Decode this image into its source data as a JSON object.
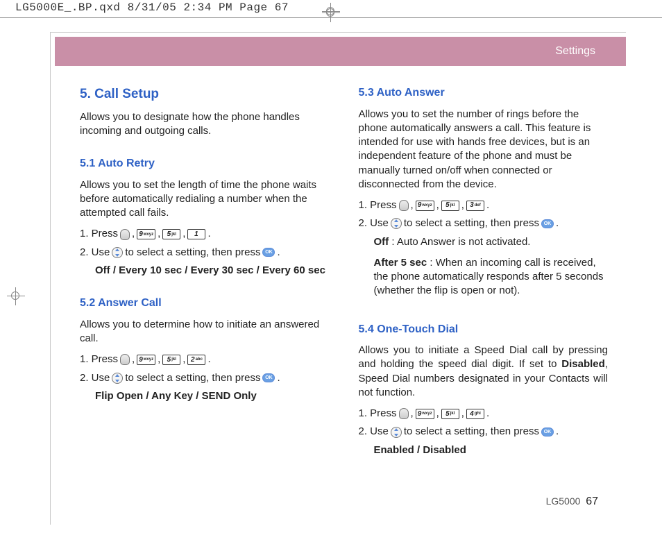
{
  "crop_header": "LG5000E_.BP.qxd  8/31/05  2:34 PM  Page 67",
  "banner_title": "Settings",
  "footer_model": "LG5000",
  "footer_page": "67",
  "keys": {
    "k9": {
      "num": "9",
      "lbl": "wxyz"
    },
    "k5": {
      "num": "5",
      "lbl": "jkl"
    },
    "k1": {
      "num": "1",
      "lbl": ""
    },
    "k2": {
      "num": "2",
      "lbl": "abc"
    },
    "k3": {
      "num": "3",
      "lbl": "def"
    },
    "k4": {
      "num": "4",
      "lbl": "ghi"
    },
    "ok": "OK"
  },
  "left": {
    "h2": "5. Call Setup",
    "intro": "Allows you to designate how the phone handles incoming and outgoing calls.",
    "s1": {
      "title": "5.1 Auto Retry",
      "desc": "Allows you to set the length of time the phone waits before automatically redialing a number when the attempted call fails.",
      "step1_a": "1. Press",
      "step2_a": "2. Use",
      "step2_b": "to select a setting, then press",
      "opts": "Off / Every 10 sec / Every 30 sec / Every 60 sec"
    },
    "s2": {
      "title": "5.2 Answer Call",
      "desc": "Allows you to determine how to initiate an answered call.",
      "step1_a": "1. Press",
      "step2_a": "2. Use",
      "step2_b": "to select a setting, then press",
      "opts": "Flip Open / Any Key / SEND Only"
    }
  },
  "right": {
    "s3": {
      "title": "5.3 Auto Answer",
      "desc": "Allows you to set the number of rings before the phone automatically answers a call. This feature is intended for use with hands free devices, but is an independent feature of the phone and must be manually turned on/off when connected or disconnected from the device.",
      "step1_a": "1. Press",
      "step2_a": "2. Use",
      "step2_b": "to select a setting, then press",
      "off_lbl": "Off",
      "off_txt": " : Auto Answer is not activated.",
      "after_lbl": "After 5 sec",
      "after_txt": " : When an incoming call is received, the phone automatically responds after 5 seconds (whether the flip is open or not)."
    },
    "s4": {
      "title": "5.4 One-Touch Dial",
      "desc_a": "Allows you to initiate a Speed Dial call by pressing and holding the speed dial digit. If set to ",
      "desc_bold": "Disabled",
      "desc_b": ", Speed Dial numbers designated in your Contacts will not function.",
      "step1_a": "1. Press",
      "step2_a": "2. Use",
      "step2_b": "to select a setting, then press",
      "opts": "Enabled / Disabled"
    }
  }
}
